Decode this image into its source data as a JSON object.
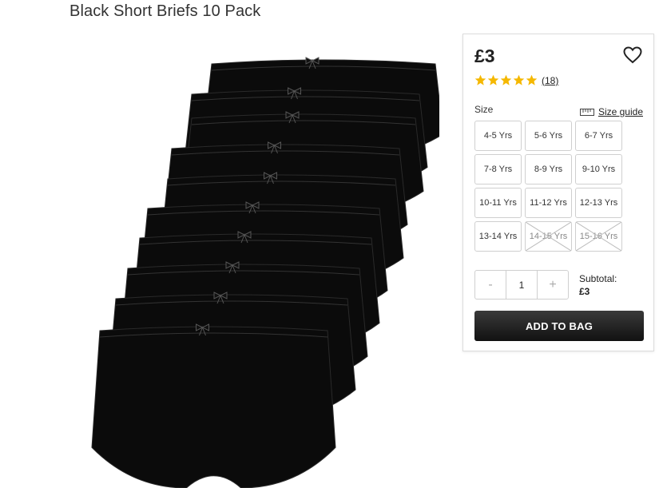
{
  "product": {
    "title": "Black Short Briefs 10 Pack",
    "price": "£3",
    "rating": 5,
    "review_count": "(18)"
  },
  "size_section": {
    "label": "Size",
    "guide_label": "Size guide"
  },
  "sizes": [
    {
      "label": "4-5 Yrs",
      "available": true
    },
    {
      "label": "5-6 Yrs",
      "available": true
    },
    {
      "label": "6-7 Yrs",
      "available": true
    },
    {
      "label": "7-8 Yrs",
      "available": true
    },
    {
      "label": "8-9 Yrs",
      "available": true
    },
    {
      "label": "9-10 Yrs",
      "available": true
    },
    {
      "label": "10-11 Yrs",
      "available": true
    },
    {
      "label": "11-12 Yrs",
      "available": true
    },
    {
      "label": "12-13 Yrs",
      "available": true
    },
    {
      "label": "13-14 Yrs",
      "available": true
    },
    {
      "label": "14-15 Yrs",
      "available": false
    },
    {
      "label": "15-16 Yrs",
      "available": false
    }
  ],
  "quantity": {
    "minus": "-",
    "value": "1",
    "plus": "+"
  },
  "subtotal": {
    "label": "Subtotal:",
    "amount": "£3"
  },
  "actions": {
    "add_to_bag": "ADD TO BAG"
  },
  "colors": {
    "star": "#f5b800",
    "button": "#222222",
    "garment": "#0b0b0b"
  },
  "icons": [
    "heart-icon",
    "star-icon",
    "ruler-icon"
  ]
}
